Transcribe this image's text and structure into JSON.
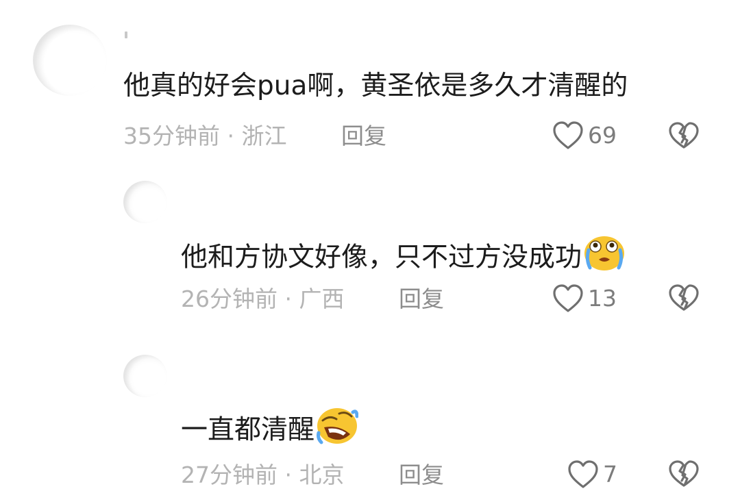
{
  "comments": [
    {
      "text": "他真的好会pua啊，黄圣依是多久才清醒的",
      "meta": "35分钟前 · 浙江",
      "reply_label": "回复",
      "likes": "69",
      "emoji": ""
    },
    {
      "text": "他和方协文好像，只不过方没成功",
      "meta": "26分钟前 · 广西",
      "reply_label": "回复",
      "likes": "13",
      "emoji": "crying-face"
    },
    {
      "text": "一直都清醒",
      "meta": "27分钟前 · 北京",
      "reply_label": "回复",
      "likes": "7",
      "emoji": "rofl-face"
    }
  ],
  "colors": {
    "text": "#1c1c1c",
    "meta": "#b3b3b3",
    "reply": "#8d8d8d",
    "icon": "#6f6f6f",
    "emoji_yellow": "#f7c531"
  },
  "icons": {
    "like": "heart-outline-icon",
    "dislike": "broken-heart-icon"
  }
}
